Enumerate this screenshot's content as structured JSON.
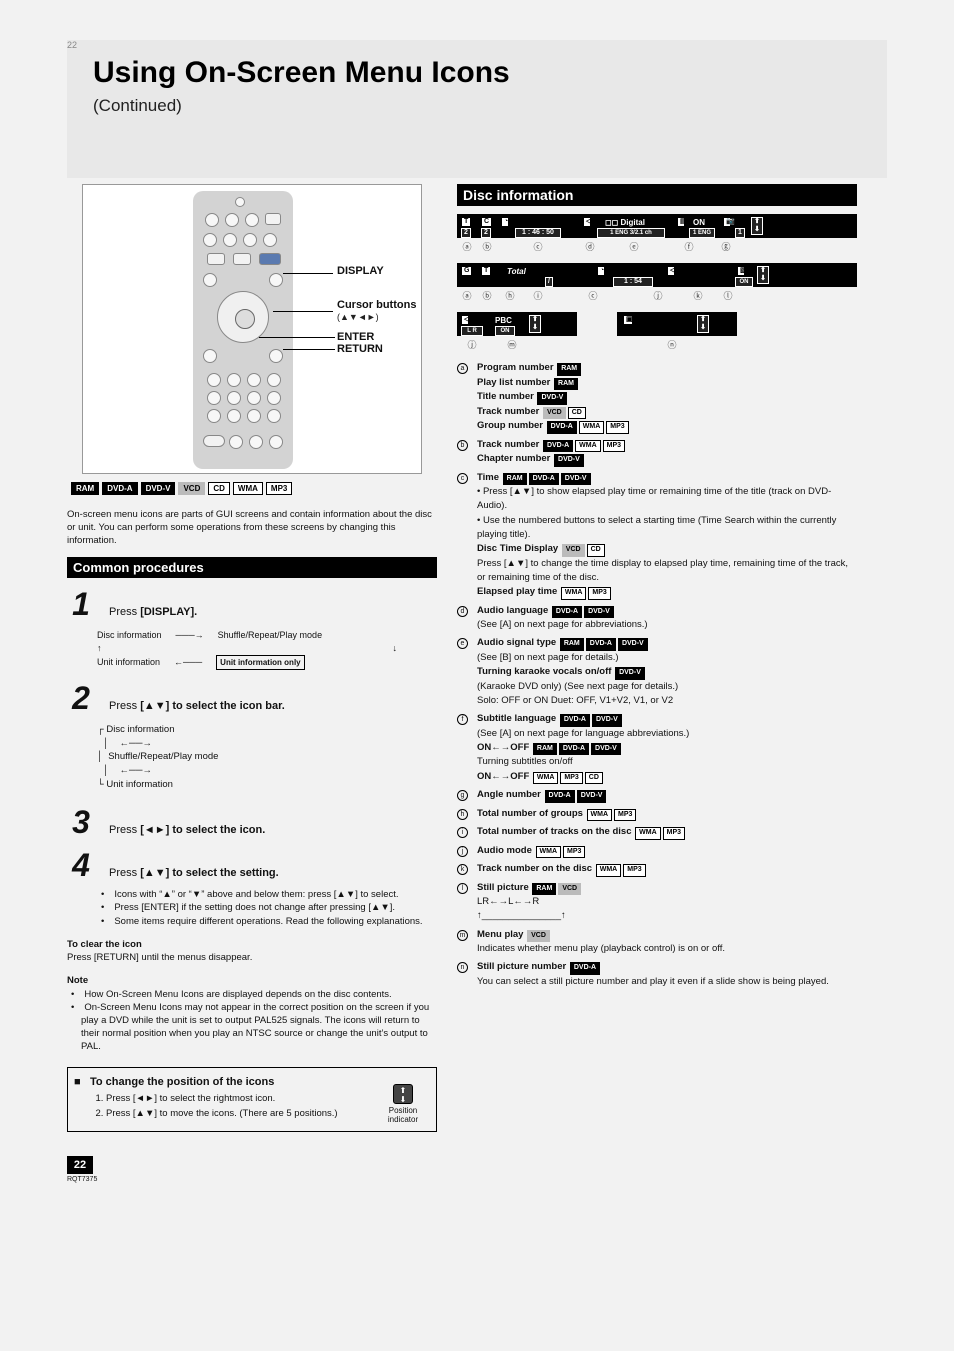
{
  "page_number_top": "22",
  "band": {
    "title": "Using On-Screen Menu Icons",
    "subtitle": "(Continued)"
  },
  "remote": {
    "cursor_label": "Cursor buttons",
    "cursor_glyphs": "(▲▼◄►)",
    "enter_label": "ENTER",
    "display_label": "DISPLAY",
    "return_label": "RETURN"
  },
  "left_col": {
    "disc_tags": [
      "RAM",
      "DVD-A",
      "DVD-V",
      "VCD",
      "CD",
      "WMA",
      "MP3"
    ],
    "intro_note": "On-screen menu icons are parts of GUI screens and contain information about the disc or unit. You can perform some operations from these screens by changing this information.",
    "common_bar": "Common procedures",
    "step1_a": "Press ",
    "step1_b": "[DISPLAY].",
    "cycle": {
      "a": "Disc information",
      "b": "Shuffle/Repeat/Play mode",
      "c": "Unit information only",
      "d": "Unit information",
      "arrows": "→  ↓  ←  ↑"
    },
    "step2_a": "Press ",
    "step2_b": "[▲▼] ",
    "step2_c": "to select the icon bar.",
    "diagram": {
      "l1": "Disc information",
      "l2": "Shuffle/Repeat/Play mode",
      "l3": "Unit information"
    },
    "step3_a": "Press ",
    "step3_b": "[◄►] ",
    "step3_c": "to select the icon.",
    "step4_a": "Press ",
    "step4_b": "[▲▼] ",
    "step4_c": "to select the setting.",
    "bullets4": [
      "Icons with “▲” or “▼” above and below them: press [▲▼] to select.",
      "Press [ENTER] if the setting does not change after pressing [▲▼].",
      "Some items require different operations. Read the following explanations."
    ],
    "clear_title": "To clear the icon",
    "clear_body": "Press [RETURN] until the menus disappear.",
    "note_title": "Note",
    "notes": [
      "How On-Screen Menu Icons are displayed depends on the disc contents.",
      "On-Screen Menu Icons may not appear in the correct position on the screen if you play a DVD while the unit is set to output PAL525 signals. The icons will return to their normal position when you play an NTSC source or change the unit’s output to PAL."
    ],
    "change_title": "To change the position of the icons",
    "change_body1": "Press [◄►] to select the rightmost icon.",
    "change_body2": "Press [▲▼] to move the icons. (There are 5 positions.)",
    "change_icon_label": "Position indicator"
  },
  "right_col": {
    "bar": "Disc information",
    "strip1": {
      "t": "T",
      "t_v": "2",
      "c": "C",
      "c_v": "2",
      "time": "1 : 46 : 50",
      "aud": "1 ENG  3/2.1 ch",
      "digital": "Digital",
      "sub": "ON",
      "sub2": "1 ENG",
      "ang": "1"
    },
    "strip1_letters": [
      "a",
      "b",
      "c",
      "d",
      "e",
      "f",
      "g"
    ],
    "strip2": {
      "g": "G",
      "t": "T",
      "total": "Total",
      "sep": "/",
      "time": "1 : 54",
      "aud": "",
      "pbc": "ON"
    },
    "strip2_letters": [
      "a",
      "b",
      "h",
      "i",
      "c",
      "j",
      "k",
      "l"
    ],
    "strip3": {
      "aud": "L R",
      "pbc": "PBC",
      "pbc_v": "ON"
    },
    "strip3_letters": [
      "j",
      "m",
      "n"
    ],
    "glossary": [
      {
        "k": "a",
        "lines": [
          {
            "pre": "Program number",
            "tags": [
              {
                "t": "RAM",
                "c": "dark"
              }
            ]
          },
          {
            "pre": "Play list number",
            "tags": [
              {
                "t": "RAM",
                "c": "dark"
              }
            ]
          },
          {
            "pre": "Title number",
            "tags": [
              {
                "t": "DVD-V",
                "c": "dark"
              }
            ]
          },
          {
            "pre": "Track number",
            "tags": [
              {
                "t": "VCD",
                "c": "gray"
              },
              {
                "t": "CD",
                "c": ""
              }
            ]
          },
          {
            "pre": "Group number",
            "tags": [
              {
                "t": "DVD-A",
                "c": "dark"
              },
              {
                "t": "WMA",
                "c": ""
              },
              {
                "t": "MP3",
                "c": ""
              }
            ]
          }
        ]
      },
      {
        "k": "b",
        "lines": [
          {
            "pre": "Track number",
            "tags": [
              {
                "t": "DVD-A",
                "c": "dark"
              },
              {
                "t": "WMA",
                "c": ""
              },
              {
                "t": "MP3",
                "c": ""
              }
            ]
          },
          {
            "pre": "Chapter number",
            "tags": [
              {
                "t": "DVD-V",
                "c": "dark"
              }
            ]
          }
        ]
      },
      {
        "k": "c",
        "lines": [
          {
            "pre": "Time",
            "tags": [
              {
                "t": "RAM",
                "c": "dark"
              },
              {
                "t": "DVD-A",
                "c": "dark"
              },
              {
                "t": "DVD-V",
                "c": "dark"
              }
            ]
          },
          {
            "pre": "• Press [▲▼] to show elapsed play time or remaining time of the title (track on DVD-Audio).",
            "tags": []
          },
          {
            "pre": "• Use the numbered buttons to select a starting time (Time Search within the currently playing title).",
            "tags": []
          },
          {
            "pre": "Disc Time Display",
            "tags": [
              {
                "t": "VCD",
                "c": "gray"
              },
              {
                "t": "CD",
                "c": ""
              }
            ]
          },
          {
            "pre": "Press [▲▼] to change the time display to elapsed play time, remaining time of the track, or remaining time of the disc.",
            "tags": []
          },
          {
            "pre": "Elapsed play time",
            "tags": [
              {
                "t": "WMA",
                "c": ""
              },
              {
                "t": "MP3",
                "c": ""
              }
            ]
          }
        ]
      },
      {
        "k": "d",
        "lines": [
          {
            "pre": "Audio language",
            "tags": [
              {
                "t": "DVD-A",
                "c": "dark"
              },
              {
                "t": "DVD-V",
                "c": "dark"
              }
            ]
          },
          {
            "pre": "(See [A] on next page for abbreviations.)",
            "tags": []
          }
        ]
      },
      {
        "k": "e",
        "lines": [
          {
            "pre": "Audio signal type",
            "tags": [
              {
                "t": "RAM",
                "c": "dark"
              },
              {
                "t": "DVD-A",
                "c": "dark"
              },
              {
                "t": "DVD-V",
                "c": "dark"
              }
            ]
          },
          {
            "pre": "(See [B] on next page for details.)",
            "tags": []
          },
          {
            "pre": "Turning karaoke vocals on/off",
            "tags": [
              {
                "t": "DVD-V",
                "c": "dark"
              }
            ]
          },
          {
            "pre": "(Karaoke DVD only) (See next page for details.)",
            "tags": []
          },
          {
            "pre": "Solo: OFF or ON        Duet: OFF, V1+V2, V1, or V2",
            "tags": []
          }
        ]
      },
      {
        "k": "f",
        "lines": [
          {
            "pre": "Subtitle language",
            "tags": [
              {
                "t": "DVD-A",
                "c": "dark"
              },
              {
                "t": "DVD-V",
                "c": "dark"
              }
            ]
          },
          {
            "pre": "(See [A] on next page for language abbreviations.)",
            "tags": []
          },
          {
            "pre": "ON←→OFF",
            "tags": [
              {
                "t": "RAM",
                "c": "dark"
              },
              {
                "t": "DVD-A",
                "c": "dark"
              },
              {
                "t": "DVD-V",
                "c": "dark"
              }
            ]
          },
          {
            "pre": "Turning subtitles on/off",
            "tags": []
          },
          {
            "pre": "ON←→OFF",
            "tags": [
              {
                "t": "WMA",
                "c": ""
              },
              {
                "t": "MP3",
                "c": ""
              },
              {
                "t": "CD",
                "c": ""
              }
            ]
          }
        ]
      },
      {
        "k": "g",
        "lines": [
          {
            "pre": "Angle number",
            "tags": [
              {
                "t": "DVD-A",
                "c": "dark"
              },
              {
                "t": "DVD-V",
                "c": "dark"
              }
            ]
          }
        ]
      },
      {
        "k": "h",
        "lines": [
          {
            "pre": "Total number of groups",
            "tags": [
              {
                "t": "WMA",
                "c": ""
              },
              {
                "t": "MP3",
                "c": ""
              }
            ]
          }
        ]
      },
      {
        "k": "i",
        "lines": [
          {
            "pre": "Total number of tracks on the disc",
            "tags": [
              {
                "t": "WMA",
                "c": ""
              },
              {
                "t": "MP3",
                "c": ""
              }
            ]
          }
        ]
      },
      {
        "k": "j",
        "lines": [
          {
            "pre": "Audio mode",
            "tags": [
              {
                "t": "WMA",
                "c": ""
              },
              {
                "t": "MP3",
                "c": ""
              }
            ]
          }
        ]
      },
      {
        "k": "k",
        "lines": [
          {
            "pre": "Track number on the disc",
            "tags": [
              {
                "t": "WMA",
                "c": ""
              },
              {
                "t": "MP3",
                "c": ""
              }
            ]
          }
        ]
      },
      {
        "k": "l",
        "lines": [
          {
            "pre": "Still picture",
            "tags": [
              {
                "t": "RAM",
                "c": "dark"
              },
              {
                "t": "VCD",
                "c": "gray"
              }
            ]
          },
          {
            "pre": "LR←→L←→R",
            "tags": []
          },
          {
            "pre": "↑_______________↑",
            "tags": []
          }
        ]
      },
      {
        "k": "m",
        "lines": [
          {
            "pre": "Menu play",
            "tags": [
              {
                "t": "VCD",
                "c": "gray"
              }
            ]
          },
          {
            "pre": "Indicates whether menu play (playback control) is on or off.",
            "tags": []
          }
        ]
      },
      {
        "k": "n",
        "lines": [
          {
            "pre": "Still picture number",
            "tags": [
              {
                "t": "DVD-A",
                "c": "dark"
              }
            ]
          },
          {
            "pre": "You can select a still picture number and play it even if a slide show is being played.",
            "tags": []
          }
        ]
      }
    ]
  },
  "footer": {
    "page": "22",
    "code": "RQT7375"
  }
}
